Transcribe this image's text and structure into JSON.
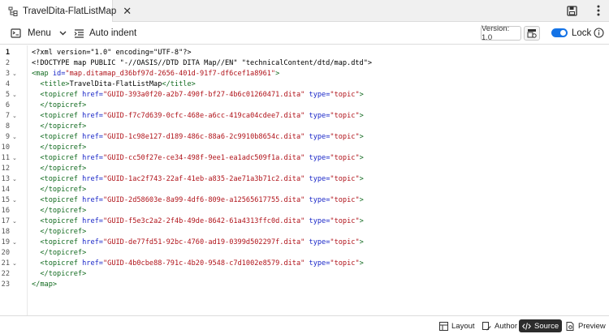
{
  "tab": {
    "title": "TravelDita-FlatListMap",
    "close": "✕",
    "icon": "map-file-icon"
  },
  "top_right_icons": [
    "save-icon",
    "more-vertical-icon"
  ],
  "toolbar": {
    "menu_label": "Menu",
    "auto_indent_label": "Auto indent",
    "version_label": "Version: 1.0",
    "lock_label": "Lock",
    "lock_enabled": true
  },
  "editor": {
    "active_line": 1,
    "lines": [
      {
        "n": "1",
        "fold": "",
        "tokens": [
          {
            "t": "txt",
            "v": "<?xml version=\"1.0\" encoding=\"UTF-8\"?>"
          }
        ]
      },
      {
        "n": "2",
        "fold": "",
        "tokens": [
          {
            "t": "txt",
            "v": "<!DOCTYPE map PUBLIC \"-//OASIS//DTD DITA Map//EN\" \"technicalContent/dtd/map.dtd\">"
          }
        ]
      },
      {
        "n": "3",
        "fold": "⌄",
        "tokens": [
          {
            "t": "tag",
            "v": "<map "
          },
          {
            "t": "attr",
            "v": "id="
          },
          {
            "t": "val",
            "v": "\"map.ditamap_d36bf97d-2656-401d-91f7-df6cef1a8961\""
          },
          {
            "t": "tag",
            "v": ">"
          }
        ]
      },
      {
        "n": "4",
        "fold": "",
        "tokens": [
          {
            "t": "txt",
            "v": "  "
          },
          {
            "t": "tag",
            "v": "<title>"
          },
          {
            "t": "txt",
            "v": "TravelDita-FlatListMap"
          },
          {
            "t": "tag",
            "v": "</title>"
          }
        ]
      },
      {
        "n": "5",
        "fold": "⌄",
        "tokens": [
          {
            "t": "txt",
            "v": "  "
          },
          {
            "t": "tag",
            "v": "<topicref "
          },
          {
            "t": "attr",
            "v": "href="
          },
          {
            "t": "val",
            "v": "\"GUID-393a0f20-a2b7-490f-bf27-4b6c01260471.dita\""
          },
          {
            "t": "txt",
            "v": " "
          },
          {
            "t": "attr",
            "v": "type="
          },
          {
            "t": "val",
            "v": "\"topic\""
          },
          {
            "t": "tag",
            "v": ">"
          }
        ]
      },
      {
        "n": "6",
        "fold": "",
        "tokens": [
          {
            "t": "txt",
            "v": "  "
          },
          {
            "t": "tag",
            "v": "</topicref>"
          }
        ]
      },
      {
        "n": "7",
        "fold": "⌄",
        "tokens": [
          {
            "t": "txt",
            "v": "  "
          },
          {
            "t": "tag",
            "v": "<topicref "
          },
          {
            "t": "attr",
            "v": "href="
          },
          {
            "t": "val",
            "v": "\"GUID-f7c7d639-0cfc-468e-a6cc-419ca04cdee7.dita\""
          },
          {
            "t": "txt",
            "v": " "
          },
          {
            "t": "attr",
            "v": "type="
          },
          {
            "t": "val",
            "v": "\"topic\""
          },
          {
            "t": "tag",
            "v": ">"
          }
        ]
      },
      {
        "n": "8",
        "fold": "",
        "tokens": [
          {
            "t": "txt",
            "v": "  "
          },
          {
            "t": "tag",
            "v": "</topicref>"
          }
        ]
      },
      {
        "n": "9",
        "fold": "⌄",
        "tokens": [
          {
            "t": "txt",
            "v": "  "
          },
          {
            "t": "tag",
            "v": "<topicref "
          },
          {
            "t": "attr",
            "v": "href="
          },
          {
            "t": "val",
            "v": "\"GUID-1c98e127-d189-486c-88a6-2c9910b8654c.dita\""
          },
          {
            "t": "txt",
            "v": " "
          },
          {
            "t": "attr",
            "v": "type="
          },
          {
            "t": "val",
            "v": "\"topic\""
          },
          {
            "t": "tag",
            "v": ">"
          }
        ]
      },
      {
        "n": "10",
        "fold": "",
        "tokens": [
          {
            "t": "txt",
            "v": "  "
          },
          {
            "t": "tag",
            "v": "</topicref>"
          }
        ]
      },
      {
        "n": "11",
        "fold": "⌄",
        "tokens": [
          {
            "t": "txt",
            "v": "  "
          },
          {
            "t": "tag",
            "v": "<topicref "
          },
          {
            "t": "attr",
            "v": "href="
          },
          {
            "t": "val",
            "v": "\"GUID-cc50f27e-ce34-498f-9ee1-ea1adc509f1a.dita\""
          },
          {
            "t": "txt",
            "v": " "
          },
          {
            "t": "attr",
            "v": "type="
          },
          {
            "t": "val",
            "v": "\"topic\""
          },
          {
            "t": "tag",
            "v": ">"
          }
        ]
      },
      {
        "n": "12",
        "fold": "",
        "tokens": [
          {
            "t": "txt",
            "v": "  "
          },
          {
            "t": "tag",
            "v": "</topicref>"
          }
        ]
      },
      {
        "n": "13",
        "fold": "⌄",
        "tokens": [
          {
            "t": "txt",
            "v": "  "
          },
          {
            "t": "tag",
            "v": "<topicref "
          },
          {
            "t": "attr",
            "v": "href="
          },
          {
            "t": "val",
            "v": "\"GUID-1ac2f743-22af-41eb-a835-2ae71a3b71c2.dita\""
          },
          {
            "t": "txt",
            "v": " "
          },
          {
            "t": "attr",
            "v": "type="
          },
          {
            "t": "val",
            "v": "\"topic\""
          },
          {
            "t": "tag",
            "v": ">"
          }
        ]
      },
      {
        "n": "14",
        "fold": "",
        "tokens": [
          {
            "t": "txt",
            "v": "  "
          },
          {
            "t": "tag",
            "v": "</topicref>"
          }
        ]
      },
      {
        "n": "15",
        "fold": "⌄",
        "tokens": [
          {
            "t": "txt",
            "v": "  "
          },
          {
            "t": "tag",
            "v": "<topicref "
          },
          {
            "t": "attr",
            "v": "href="
          },
          {
            "t": "val",
            "v": "\"GUID-2d58603e-8a99-4df6-809e-a12565617755.dita\""
          },
          {
            "t": "txt",
            "v": " "
          },
          {
            "t": "attr",
            "v": "type="
          },
          {
            "t": "val",
            "v": "\"topic\""
          },
          {
            "t": "tag",
            "v": ">"
          }
        ]
      },
      {
        "n": "16",
        "fold": "",
        "tokens": [
          {
            "t": "txt",
            "v": "  "
          },
          {
            "t": "tag",
            "v": "</topicref>"
          }
        ]
      },
      {
        "n": "17",
        "fold": "⌄",
        "tokens": [
          {
            "t": "txt",
            "v": "  "
          },
          {
            "t": "tag",
            "v": "<topicref "
          },
          {
            "t": "attr",
            "v": "href="
          },
          {
            "t": "val",
            "v": "\"GUID-f5e3c2a2-2f4b-49de-8642-61a4313ffc0d.dita\""
          },
          {
            "t": "txt",
            "v": " "
          },
          {
            "t": "attr",
            "v": "type="
          },
          {
            "t": "val",
            "v": "\"topic\""
          },
          {
            "t": "tag",
            "v": ">"
          }
        ]
      },
      {
        "n": "18",
        "fold": "",
        "tokens": [
          {
            "t": "txt",
            "v": "  "
          },
          {
            "t": "tag",
            "v": "</topicref>"
          }
        ]
      },
      {
        "n": "19",
        "fold": "⌄",
        "tokens": [
          {
            "t": "txt",
            "v": "  "
          },
          {
            "t": "tag",
            "v": "<topicref "
          },
          {
            "t": "attr",
            "v": "href="
          },
          {
            "t": "val",
            "v": "\"GUID-de77fd51-92bc-4760-ad19-0399d502297f.dita\""
          },
          {
            "t": "txt",
            "v": " "
          },
          {
            "t": "attr",
            "v": "type="
          },
          {
            "t": "val",
            "v": "\"topic\""
          },
          {
            "t": "tag",
            "v": ">"
          }
        ]
      },
      {
        "n": "20",
        "fold": "",
        "tokens": [
          {
            "t": "txt",
            "v": "  "
          },
          {
            "t": "tag",
            "v": "</topicref>"
          }
        ]
      },
      {
        "n": "21",
        "fold": "⌄",
        "tokens": [
          {
            "t": "txt",
            "v": "  "
          },
          {
            "t": "tag",
            "v": "<topicref "
          },
          {
            "t": "attr",
            "v": "href="
          },
          {
            "t": "val",
            "v": "\"GUID-4b0cbe88-791c-4b20-9548-c7d1002e8579.dita\""
          },
          {
            "t": "txt",
            "v": " "
          },
          {
            "t": "attr",
            "v": "type="
          },
          {
            "t": "val",
            "v": "\"topic\""
          },
          {
            "t": "tag",
            "v": ">"
          }
        ]
      },
      {
        "n": "22",
        "fold": "",
        "tokens": [
          {
            "t": "txt",
            "v": "  "
          },
          {
            "t": "tag",
            "v": "</topicref>"
          }
        ]
      },
      {
        "n": "23",
        "fold": "",
        "tokens": [
          {
            "t": "tag",
            "v": "</map>"
          }
        ]
      }
    ]
  },
  "bottom_tabs": [
    {
      "label": "Layout",
      "icon": "layout-icon",
      "active": false
    },
    {
      "label": "Author",
      "icon": "author-icon",
      "active": false
    },
    {
      "label": "Source",
      "icon": "source-code-icon",
      "active": true
    },
    {
      "label": "Preview",
      "icon": "preview-icon",
      "active": false
    }
  ],
  "colors": {
    "tag": "#116a1f",
    "attr": "#1a27c8",
    "value": "#b0131a",
    "accent": "#1473e6",
    "active_tab_bg": "#2c2c2c"
  }
}
